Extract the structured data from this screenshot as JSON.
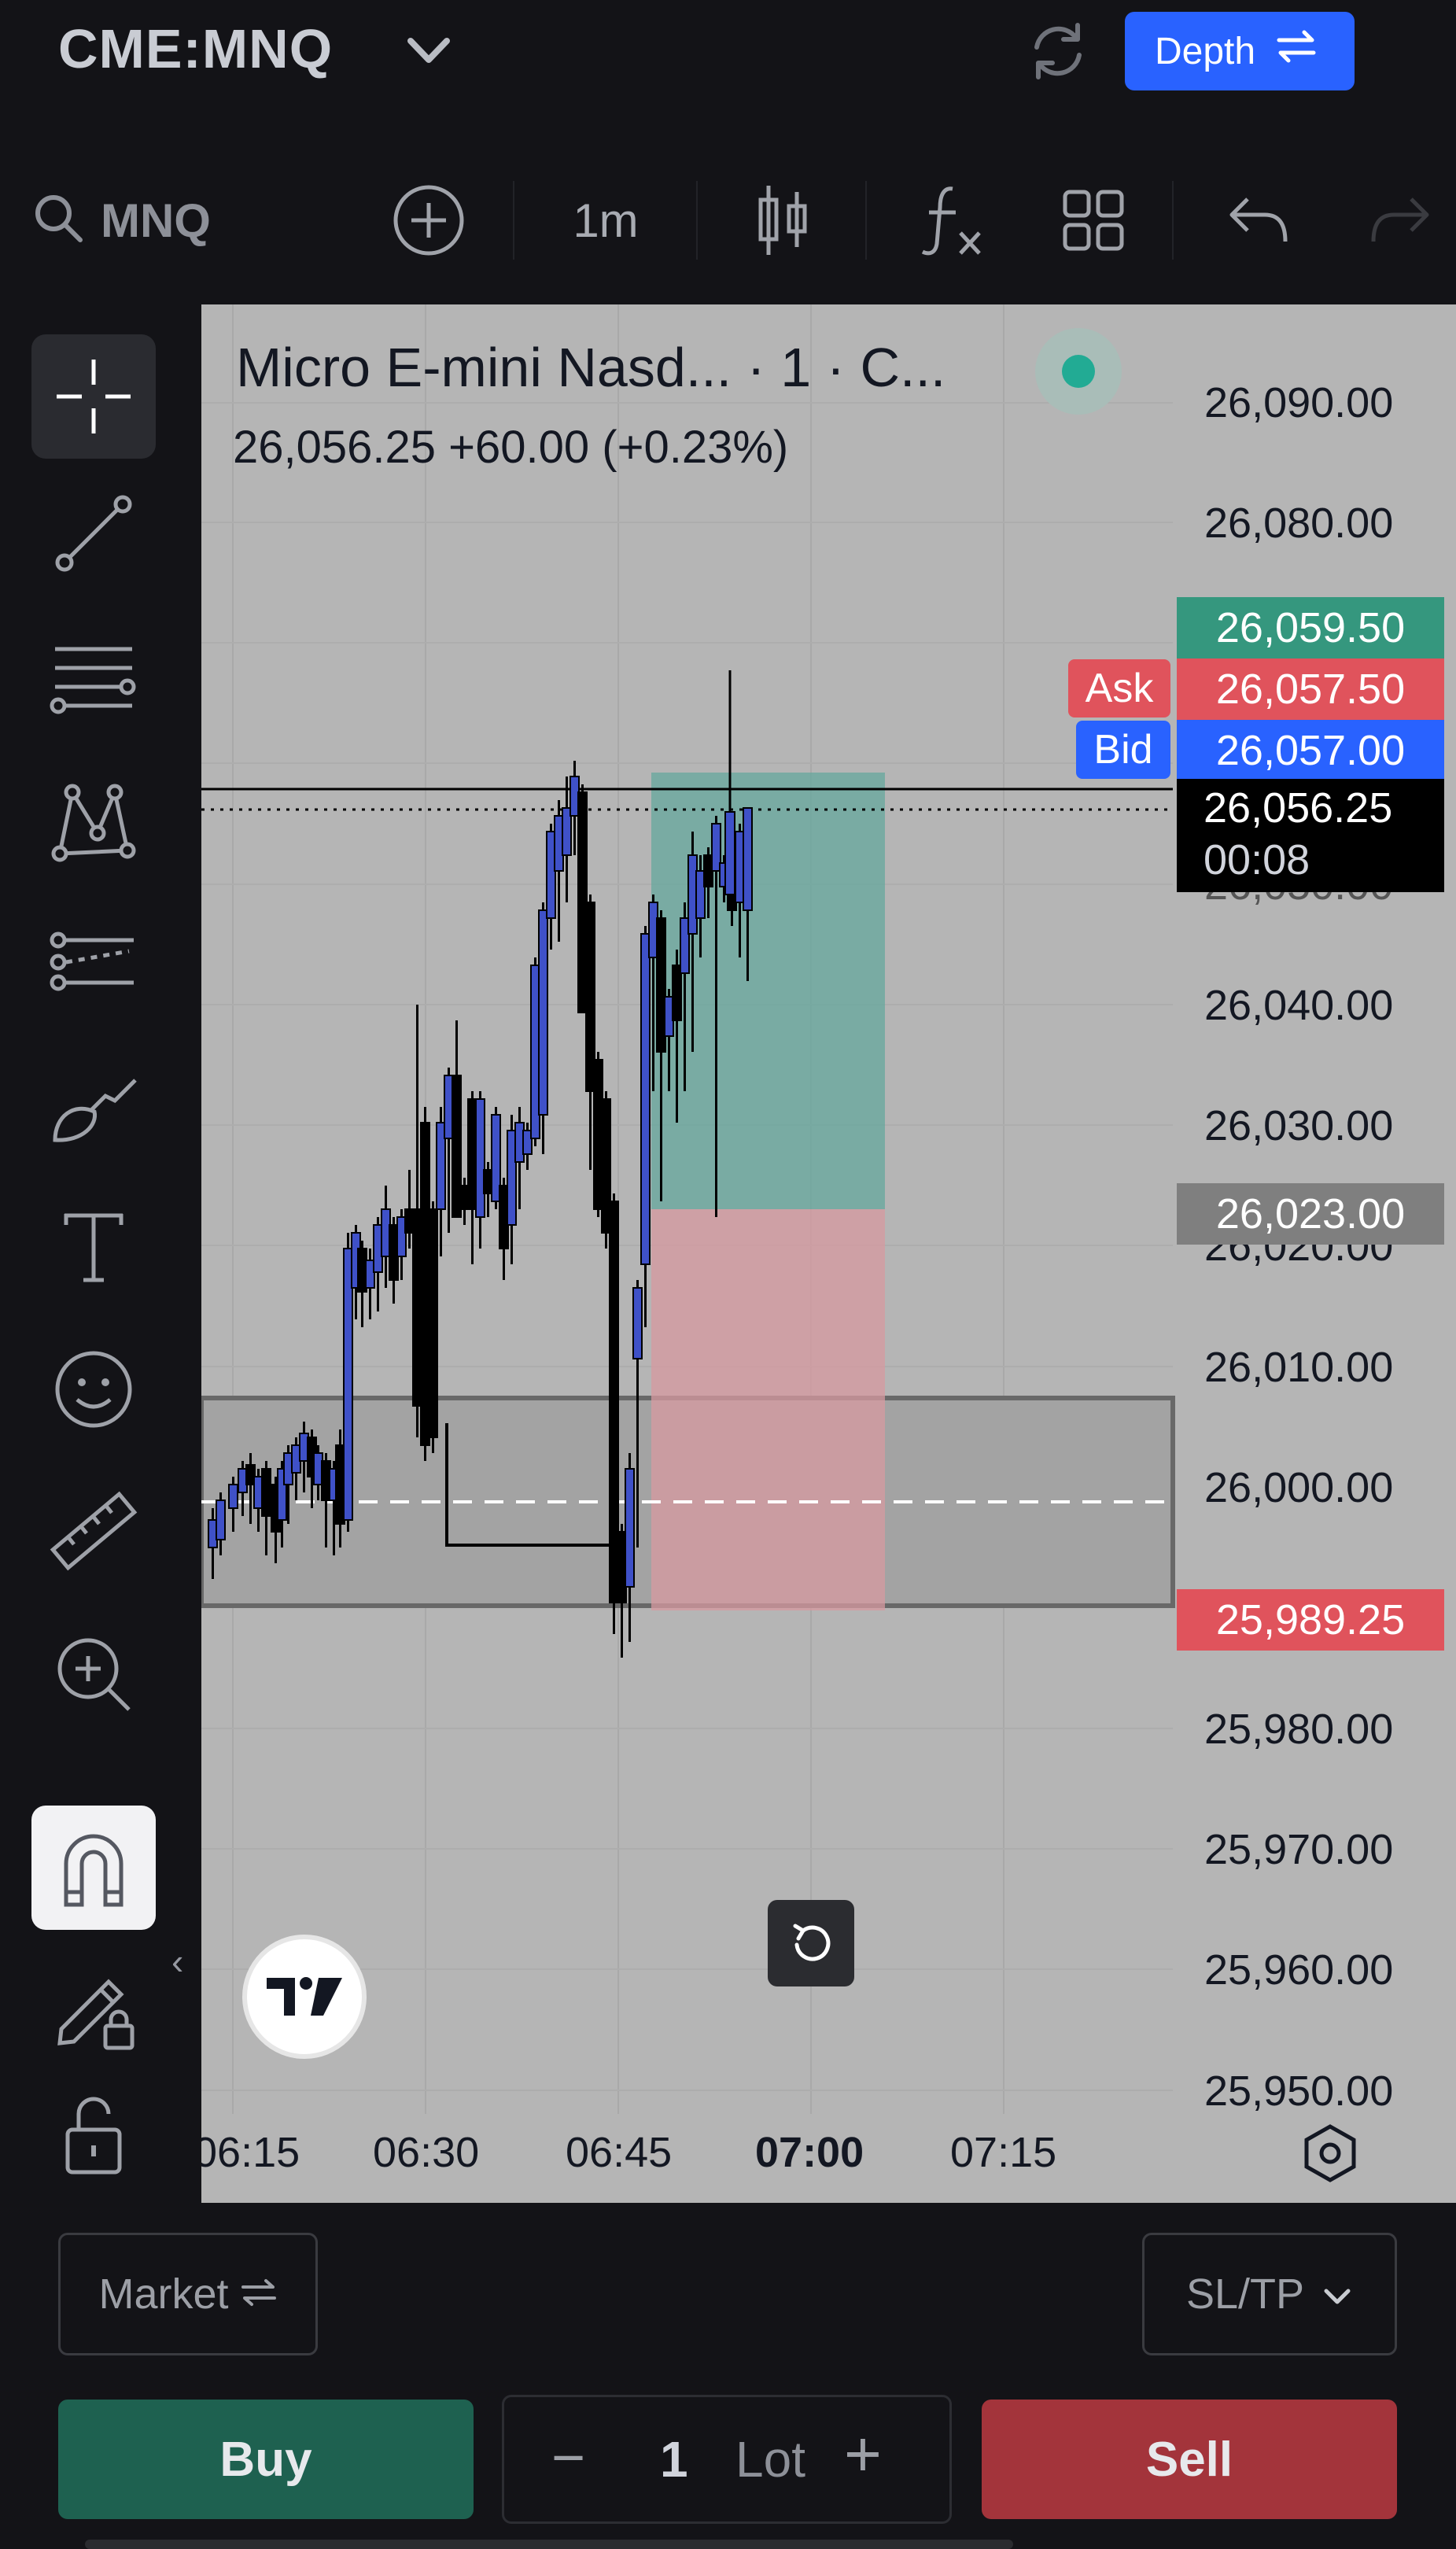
{
  "header": {
    "symbol": "CME:MNQ",
    "depth_label": "Depth"
  },
  "toolbar": {
    "search_text": "MNQ",
    "interval": "1m",
    "icons": [
      "search-icon",
      "add-symbol-icon",
      "candles-icon",
      "indicators-icon",
      "layout-icon",
      "undo-icon",
      "redo-icon"
    ]
  },
  "left_tools": [
    "crosshair-icon",
    "trend-line-icon",
    "fib-retracement-icon",
    "pattern-icon",
    "forecast-icon",
    "brush-icon",
    "text-icon",
    "emoji-icon",
    "ruler-icon",
    "zoom-in-icon",
    "magnet-icon",
    "lock-drawing-icon",
    "unlock-icon"
  ],
  "chart": {
    "title": "Micro E-mini Nasd...  · 1 · C...",
    "quote": "26,056.25  +60.00 (+0.23%)",
    "price_axis": [
      "26,090.00",
      "26,080.00",
      "26,040.00",
      "26,030.00",
      "26,020.00",
      "26,010.00",
      "26,000.00",
      "25,980.00",
      "25,970.00",
      "25,960.00",
      "25,950.00"
    ],
    "time_axis": [
      "06:15",
      "06:30",
      "06:45",
      "07:00",
      "07:15"
    ],
    "tags": {
      "target": "26,059.50",
      "ask_label": "Ask",
      "ask": "26,057.50",
      "bid_label": "Bid",
      "bid": "26,057.00",
      "last": "26,056.25",
      "countdown": "00:08",
      "entry": "26,023.00",
      "stop": "25,989.25"
    },
    "colors": {
      "up_candle": "#3f51c8",
      "down_candle": "#000000",
      "target_zone": "#66a89d",
      "stop_zone": "#d79aa0",
      "ask": "#e0535c",
      "bid": "#2962ff",
      "target_tag": "#35977e"
    }
  },
  "order": {
    "market_label": "Market",
    "sltp_label": "SL/TP",
    "buy_label": "Buy",
    "sell_label": "Sell",
    "quantity": "1",
    "unit": "Lot",
    "minus": "−",
    "plus": "+"
  }
}
